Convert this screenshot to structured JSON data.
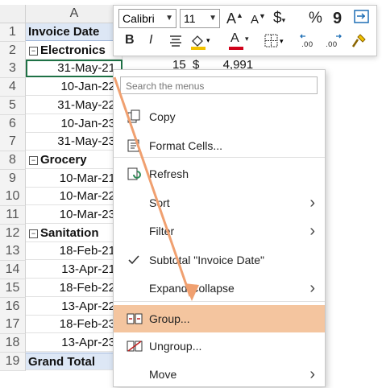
{
  "sheet": {
    "column_header": "A",
    "rows": [
      {
        "n": "1",
        "text": "Invoice Date",
        "kind": "hdr"
      },
      {
        "n": "2",
        "text": "Electronics",
        "kind": "group"
      },
      {
        "n": "3",
        "text": "31-May-21",
        "kind": "date"
      },
      {
        "n": "4",
        "text": "10-Jan-22",
        "kind": "date"
      },
      {
        "n": "5",
        "text": "31-May-22",
        "kind": "date"
      },
      {
        "n": "6",
        "text": "10-Jan-23",
        "kind": "date"
      },
      {
        "n": "7",
        "text": "31-May-23",
        "kind": "date"
      },
      {
        "n": "8",
        "text": "Grocery",
        "kind": "group"
      },
      {
        "n": "9",
        "text": "10-Mar-21",
        "kind": "date"
      },
      {
        "n": "10",
        "text": "10-Mar-22",
        "kind": "date"
      },
      {
        "n": "11",
        "text": "10-Mar-23",
        "kind": "date"
      },
      {
        "n": "12",
        "text": "Sanitation",
        "kind": "group"
      },
      {
        "n": "13",
        "text": "18-Feb-21",
        "kind": "date"
      },
      {
        "n": "14",
        "text": "13-Apr-21",
        "kind": "date"
      },
      {
        "n": "15",
        "text": "18-Feb-22",
        "kind": "date"
      },
      {
        "n": "16",
        "text": "13-Apr-22",
        "kind": "date"
      },
      {
        "n": "17",
        "text": "18-Feb-23",
        "kind": "date"
      },
      {
        "n": "18",
        "text": "13-Apr-23",
        "kind": "date"
      },
      {
        "n": "19",
        "text": "Grand Total",
        "kind": "total"
      }
    ],
    "collapse_symbol": "⊟",
    "filter_symbol": "▾",
    "row3_partial_values": {
      "qty": "15",
      "currency": "$",
      "amount": "4,991"
    }
  },
  "mini_toolbar": {
    "font_name": "Calibri",
    "font_size": "11",
    "grow_font": "A",
    "shrink_font": "A",
    "currency": "$",
    "percent": "%",
    "comma": "9",
    "bold": "B",
    "italic": "I",
    "font_color_letter": "A",
    "accent_fill": "#f2c200",
    "accent_font": "#d0021b"
  },
  "menu": {
    "search_placeholder": "Search the menus",
    "items": [
      {
        "label": "Copy",
        "icon": "copy-icon",
        "submenu": false
      },
      {
        "label": "Format Cells...",
        "icon": "format-cells-icon",
        "submenu": false
      },
      {
        "label": "Refresh",
        "icon": "refresh-icon",
        "submenu": false
      },
      {
        "label": "Sort",
        "icon": "",
        "submenu": true
      },
      {
        "label": "Filter",
        "icon": "",
        "submenu": true
      },
      {
        "label": "Subtotal \"Invoice Date\"",
        "icon": "checkmark-icon",
        "submenu": false
      },
      {
        "label": "Expand/Collapse",
        "icon": "",
        "submenu": true
      },
      {
        "label": "Group...",
        "icon": "group-icon",
        "submenu": false
      },
      {
        "label": "Ungroup...",
        "icon": "ungroup-icon",
        "submenu": false
      },
      {
        "label": "Move",
        "icon": "",
        "submenu": true
      }
    ],
    "highlight_color": "#f4c59f",
    "arrow_color": "#f0a070"
  }
}
